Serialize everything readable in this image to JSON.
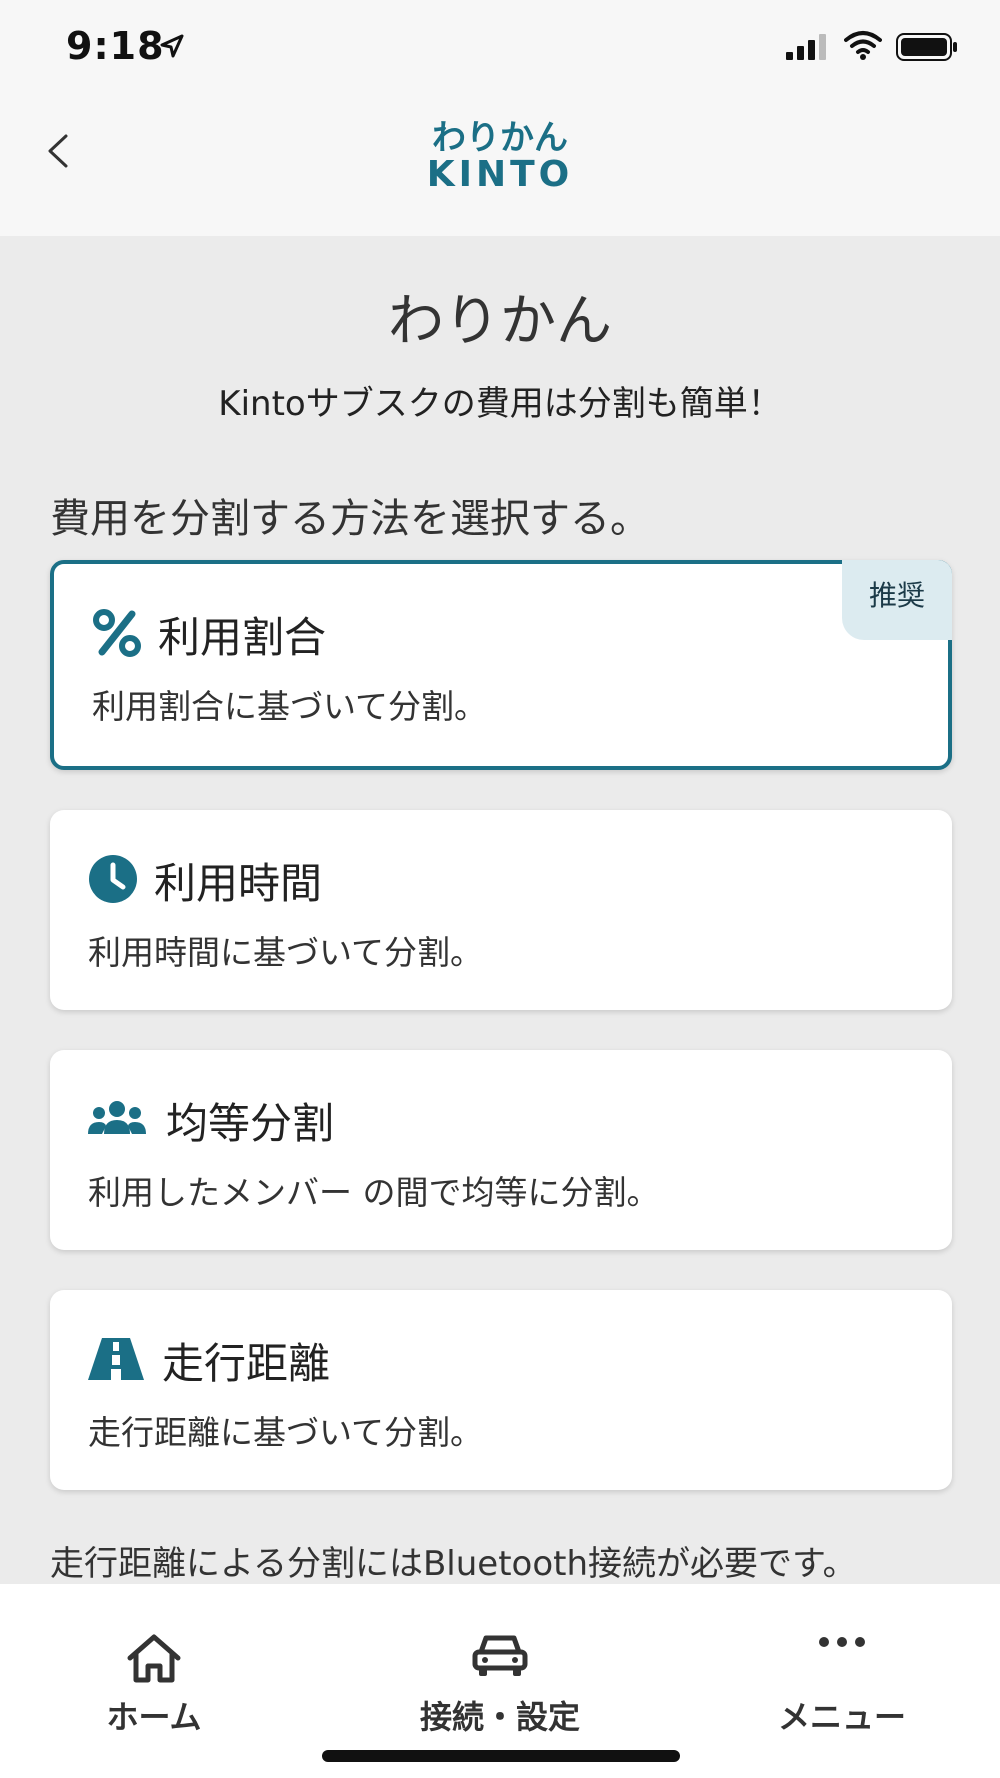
{
  "status_bar": {
    "time": "9:18"
  },
  "header": {
    "logo_line1": "わりかん",
    "logo_line2": "KINTO"
  },
  "main": {
    "title": "わりかん",
    "subtitle": "Kintoサブスクの費用は分割も簡単！",
    "section_heading": "費用を分割する方法を選択する。",
    "options": [
      {
        "title": "利用割合",
        "description": "利用割合に基づいて分割。",
        "badge": "推奨",
        "icon": "percent-icon",
        "selected": true
      },
      {
        "title": "利用時間",
        "description": "利用時間に基づいて分割。",
        "icon": "clock-icon",
        "selected": false
      },
      {
        "title": "均等分割",
        "description": "利用したメンバー の間で均等に分割。",
        "icon": "group-icon",
        "selected": false
      },
      {
        "title": "走行距離",
        "description": "走行距離に基づいて分割。",
        "icon": "road-icon",
        "selected": false
      }
    ],
    "note": "走行距離による分割にはBluetooth接続が必要です。"
  },
  "tab_bar": {
    "items": [
      {
        "label": "ホーム",
        "icon": "home-icon"
      },
      {
        "label": "接続・設定",
        "icon": "car-icon"
      },
      {
        "label": "メニュー",
        "icon": "more-icon"
      }
    ]
  },
  "colors": {
    "accent": "#1b6f86",
    "background": "#ebebeb",
    "card": "#ffffff",
    "badge_bg": "#dcebf0"
  }
}
